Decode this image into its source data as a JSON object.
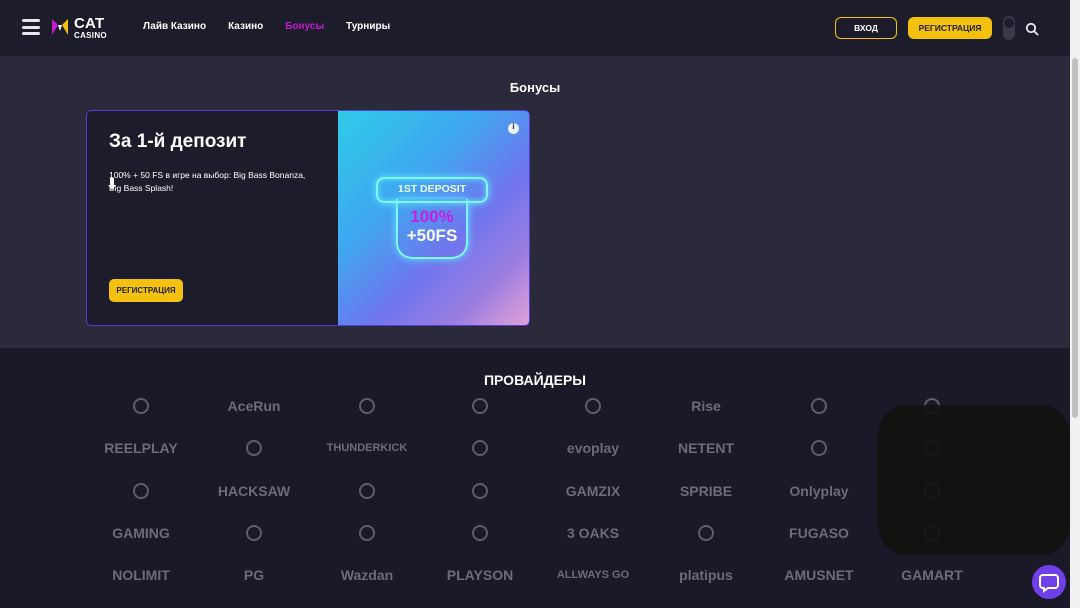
{
  "header": {
    "logo_text": "CAT",
    "logo_sub": "CASINO",
    "nav": [
      {
        "label": "Лайв Казино",
        "active": false
      },
      {
        "label": "Казино",
        "active": false
      },
      {
        "label": "Бонусы",
        "active": true
      },
      {
        "label": "Турниры",
        "active": false
      }
    ],
    "login_label": "ВХОД",
    "register_label": "РЕГИСТРАЦИЯ",
    "icons": [
      "menu-icon",
      "cat-logo-icon",
      "theme-toggle-icon",
      "search-icon"
    ]
  },
  "bonuses": {
    "section_title": "Бонусы",
    "card": {
      "title": "За 1-й депозит",
      "description": "100% + 50 FS в игре на выбор: Big Bass Bonanza, Big Bass Splash!",
      "button_label": "РЕГИСТРАЦИЯ",
      "image": {
        "badge_label": "1ST DEPOSIT",
        "value_percent": "100%",
        "value_fs": "+50FS"
      }
    }
  },
  "providers": {
    "section_title": "ПРОВАЙДЕРЫ",
    "items": [
      "",
      "AceRun",
      "",
      "",
      "",
      "Rise",
      "",
      "",
      "REELPLAY",
      "",
      "THUNDERKICK",
      "",
      "evoplay",
      "NETENT",
      "",
      "",
      "",
      "HACKSAW",
      "",
      "",
      "GAMZIX",
      "SPRIBE",
      "Onlyplay",
      "",
      "GAMING",
      "",
      "",
      "",
      "3 OAKS",
      "",
      "FUGASO",
      "",
      "NOLIMIT",
      "PG",
      "Wazdan",
      "PLAYSON",
      "ALLWAYS GO",
      "platipus",
      "AMUSNET",
      "GAMART"
    ]
  },
  "colors": {
    "accent_yellow": "#f4c10f",
    "active_nav": "#c21bd0",
    "card_border": "#4d3fd8",
    "chat_button": "#6f40e8"
  }
}
